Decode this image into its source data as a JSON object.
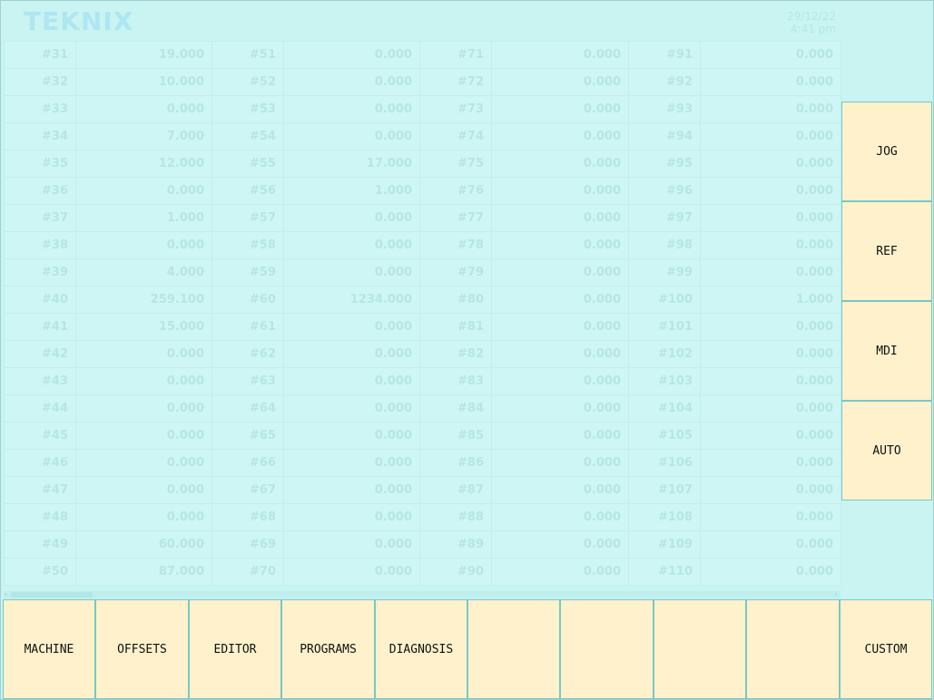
{
  "header": {
    "brand": "TEKNIX",
    "date": "29/12/22",
    "time": "4:41 pm"
  },
  "params": {
    "rows": [
      [
        [
          "#31",
          "19.000"
        ],
        [
          "#51",
          "0.000"
        ],
        [
          "#71",
          "0.000"
        ],
        [
          "#91",
          "0.000"
        ]
      ],
      [
        [
          "#32",
          "10.000"
        ],
        [
          "#52",
          "0.000"
        ],
        [
          "#72",
          "0.000"
        ],
        [
          "#92",
          "0.000"
        ]
      ],
      [
        [
          "#33",
          "0.000"
        ],
        [
          "#53",
          "0.000"
        ],
        [
          "#73",
          "0.000"
        ],
        [
          "#93",
          "0.000"
        ]
      ],
      [
        [
          "#34",
          "7.000"
        ],
        [
          "#54",
          "0.000"
        ],
        [
          "#74",
          "0.000"
        ],
        [
          "#94",
          "0.000"
        ]
      ],
      [
        [
          "#35",
          "12.000"
        ],
        [
          "#55",
          "17.000"
        ],
        [
          "#75",
          "0.000"
        ],
        [
          "#95",
          "0.000"
        ]
      ],
      [
        [
          "#36",
          "0.000"
        ],
        [
          "#56",
          "1.000"
        ],
        [
          "#76",
          "0.000"
        ],
        [
          "#96",
          "0.000"
        ]
      ],
      [
        [
          "#37",
          "1.000"
        ],
        [
          "#57",
          "0.000"
        ],
        [
          "#77",
          "0.000"
        ],
        [
          "#97",
          "0.000"
        ]
      ],
      [
        [
          "#38",
          "0.000"
        ],
        [
          "#58",
          "0.000"
        ],
        [
          "#78",
          "0.000"
        ],
        [
          "#98",
          "0.000"
        ]
      ],
      [
        [
          "#39",
          "4.000"
        ],
        [
          "#59",
          "0.000"
        ],
        [
          "#79",
          "0.000"
        ],
        [
          "#99",
          "0.000"
        ]
      ],
      [
        [
          "#40",
          "259.100"
        ],
        [
          "#60",
          "1234.000"
        ],
        [
          "#80",
          "0.000"
        ],
        [
          "#100",
          "1.000"
        ]
      ],
      [
        [
          "#41",
          "15.000"
        ],
        [
          "#61",
          "0.000"
        ],
        [
          "#81",
          "0.000"
        ],
        [
          "#101",
          "0.000"
        ]
      ],
      [
        [
          "#42",
          "0.000"
        ],
        [
          "#62",
          "0.000"
        ],
        [
          "#82",
          "0.000"
        ],
        [
          "#102",
          "0.000"
        ]
      ],
      [
        [
          "#43",
          "0.000"
        ],
        [
          "#63",
          "0.000"
        ],
        [
          "#83",
          "0.000"
        ],
        [
          "#103",
          "0.000"
        ]
      ],
      [
        [
          "#44",
          "0.000"
        ],
        [
          "#64",
          "0.000"
        ],
        [
          "#84",
          "0.000"
        ],
        [
          "#104",
          "0.000"
        ]
      ],
      [
        [
          "#45",
          "0.000"
        ],
        [
          "#65",
          "0.000"
        ],
        [
          "#85",
          "0.000"
        ],
        [
          "#105",
          "0.000"
        ]
      ],
      [
        [
          "#46",
          "0.000"
        ],
        [
          "#66",
          "0.000"
        ],
        [
          "#86",
          "0.000"
        ],
        [
          "#106",
          "0.000"
        ]
      ],
      [
        [
          "#47",
          "0.000"
        ],
        [
          "#67",
          "0.000"
        ],
        [
          "#87",
          "0.000"
        ],
        [
          "#107",
          "0.000"
        ]
      ],
      [
        [
          "#48",
          "0.000"
        ],
        [
          "#68",
          "0.000"
        ],
        [
          "#88",
          "0.000"
        ],
        [
          "#108",
          "0.000"
        ]
      ],
      [
        [
          "#49",
          "60.000"
        ],
        [
          "#69",
          "0.000"
        ],
        [
          "#89",
          "0.000"
        ],
        [
          "#109",
          "0.000"
        ]
      ],
      [
        [
          "#50",
          "87.000"
        ],
        [
          "#70",
          "0.000"
        ],
        [
          "#90",
          "0.000"
        ],
        [
          "#110",
          "0.000"
        ]
      ]
    ]
  },
  "side_buttons": [
    "JOG",
    "REF",
    "MDI",
    "AUTO"
  ],
  "bottom_buttons": [
    "MACHINE",
    "OFFSETS",
    "EDITOR",
    "PROGRAMS",
    "DIAGNOSIS",
    "",
    "",
    "",
    "",
    "CUSTOM"
  ],
  "colors": {
    "background": "#c9f4f2",
    "button_fill": "#fff1cb",
    "button_border": "#74c9c6"
  }
}
